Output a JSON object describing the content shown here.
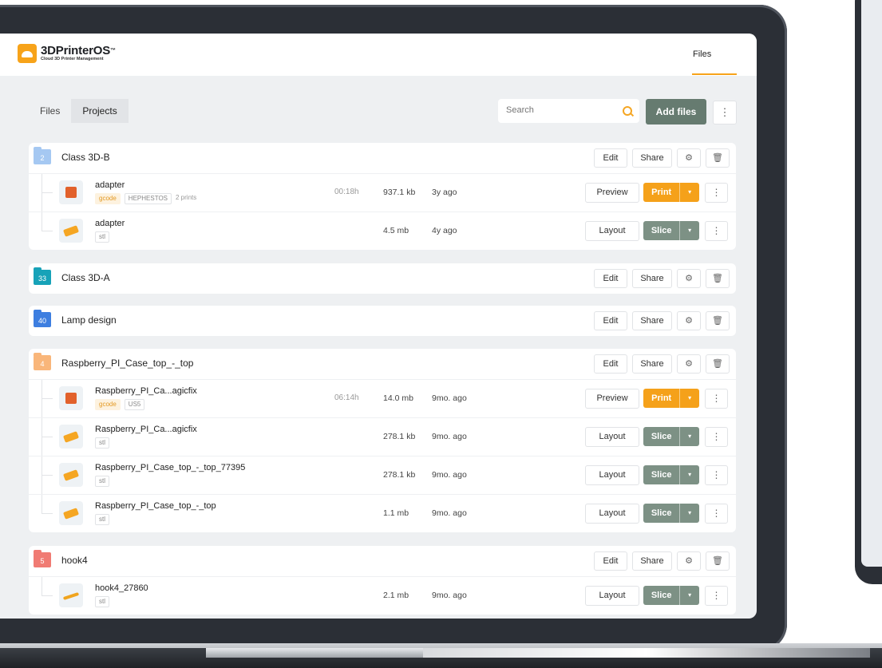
{
  "app": {
    "logo_title": "3DPrinterOS",
    "logo_tm": "™",
    "logo_subtitle": "Cloud 3D Printer Management",
    "nav_files": "Files"
  },
  "toolbar": {
    "tab_files": "Files",
    "tab_projects": "Projects",
    "search_placeholder": "Search",
    "add_files": "Add files",
    "more": "⋮"
  },
  "labels": {
    "edit": "Edit",
    "share": "Share",
    "preview": "Preview",
    "layout": "Layout",
    "print": "Print",
    "slice": "Slice",
    "caret": "▾",
    "settings_icon": "⚙",
    "delete_icon": "🗑",
    "kebab": "⋮"
  },
  "colors": {
    "accent": "#f5a11a",
    "slice": "#7d9185",
    "add_files": "#667b70"
  },
  "groups": [
    {
      "name": "Class 3D-B",
      "count": "2",
      "color": "#a5c8f2",
      "files": [
        {
          "name": "adapter",
          "tags": [
            "gcode",
            "HEPHESTOS",
            "2 prints"
          ],
          "time": "00:18h",
          "size": "937.1 kb",
          "age": "3y ago",
          "action": "Preview",
          "primary": "Print"
        },
        {
          "name": "adapter",
          "tags": [
            "stl"
          ],
          "time": "",
          "size": "4.5 mb",
          "age": "4y ago",
          "action": "Layout",
          "primary": "Slice"
        }
      ]
    },
    {
      "name": "Class 3D-A",
      "count": "33",
      "color": "#17a2b8",
      "files": []
    },
    {
      "name": "Lamp design",
      "count": "40",
      "color": "#3d7ee0",
      "files": []
    },
    {
      "name": "Raspberry_PI_Case_top_-_top",
      "count": "4",
      "color": "#f9b67a",
      "files": [
        {
          "name": "Raspberry_PI_Ca...agicfix",
          "tags": [
            "gcode",
            "US5"
          ],
          "time": "06:14h",
          "size": "14.0 mb",
          "age": "9mo. ago",
          "action": "Preview",
          "primary": "Print"
        },
        {
          "name": "Raspberry_PI_Ca...agicfix",
          "tags": [
            "stl"
          ],
          "time": "",
          "size": "278.1 kb",
          "age": "9mo. ago",
          "action": "Layout",
          "primary": "Slice"
        },
        {
          "name": "Raspberry_PI_Case_top_-_top_77395",
          "tags": [
            "stl"
          ],
          "time": "",
          "size": "278.1 kb",
          "age": "9mo. ago",
          "action": "Layout",
          "primary": "Slice"
        },
        {
          "name": "Raspberry_PI_Case_top_-_top",
          "tags": [
            "stl"
          ],
          "time": "",
          "size": "1.1 mb",
          "age": "9mo. ago",
          "action": "Layout",
          "primary": "Slice"
        }
      ]
    },
    {
      "name": "hook4",
      "count": "5",
      "color": "#f07b73",
      "files": [
        {
          "name": "hook4_27860",
          "tags": [
            "stl"
          ],
          "time": "",
          "size": "2.1 mb",
          "age": "9mo. ago",
          "action": "Layout",
          "primary": "Slice"
        }
      ]
    }
  ]
}
